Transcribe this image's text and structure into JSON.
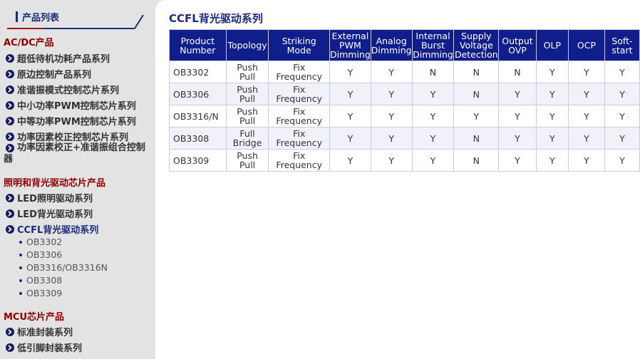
{
  "sidebar": {
    "title": "产品列表",
    "categories": [
      {
        "label": "AC/DC产品",
        "items": [
          "超低待机功耗产品系列",
          "原边控制产品系列",
          "准谐振模式控制芯片系列",
          "中小功率PWM控制芯片系列",
          "中等功率PWM控制芯片系列",
          "功率因素校正控制芯片系列",
          "功率因素校正+准谐振组合控制器"
        ]
      },
      {
        "label": "照明和背光驱动芯片产品",
        "items": [
          "LED照明驱动系列",
          "LED背光驱动系列",
          "CCFL背光驱动系列"
        ],
        "active_item": "CCFL背光驱动系列",
        "subitems": [
          "OB3302",
          "OB3306",
          "OB3316/OB3316N",
          "OB3308",
          "OB3309"
        ]
      },
      {
        "label": "MCU芯片产品",
        "items": [
          "标准封装系列",
          "低引脚封装系列"
        ]
      }
    ]
  },
  "main": {
    "title": "CCFL背光驱动系列",
    "table": {
      "headers": [
        "Product Number",
        "Topology",
        "Striking Mode",
        "External PWM Dimming",
        "Analog Dimming",
        "Internal Burst Dimming",
        "Supply Voltage Detection",
        "Output OVP",
        "OLP",
        "OCP",
        "Soft-start"
      ],
      "rows": [
        [
          "OB3302",
          "Push Pull",
          "Fix Frequency",
          "Y",
          "Y",
          "N",
          "N",
          "N",
          "Y",
          "Y",
          "Y"
        ],
        [
          "OB3306",
          "Push Pull",
          "Fix Frequency",
          "Y",
          "Y",
          "Y",
          "N",
          "Y",
          "Y",
          "Y",
          "Y"
        ],
        [
          "OB3316/N",
          "Push Pull",
          "Fix Frequency",
          "Y",
          "Y",
          "Y",
          "Y",
          "Y",
          "Y",
          "Y",
          "Y"
        ],
        [
          "OB3308",
          "Full Bridge",
          "Fix Frequency",
          "Y",
          "Y",
          "Y",
          "N",
          "Y",
          "Y",
          "Y",
          "Y"
        ],
        [
          "OB3309",
          "Push Pull",
          "Fix Frequency",
          "Y",
          "Y",
          "Y",
          "N",
          "Y",
          "Y",
          "Y",
          "Y"
        ]
      ]
    }
  },
  "colors": {
    "header_bg": "#0f1e8a",
    "category_red": "#8b0000",
    "accent_navy": "#1b2a7a",
    "sidebar_bg": "#e3e3e3",
    "row_alt": "#f1f2f9"
  }
}
